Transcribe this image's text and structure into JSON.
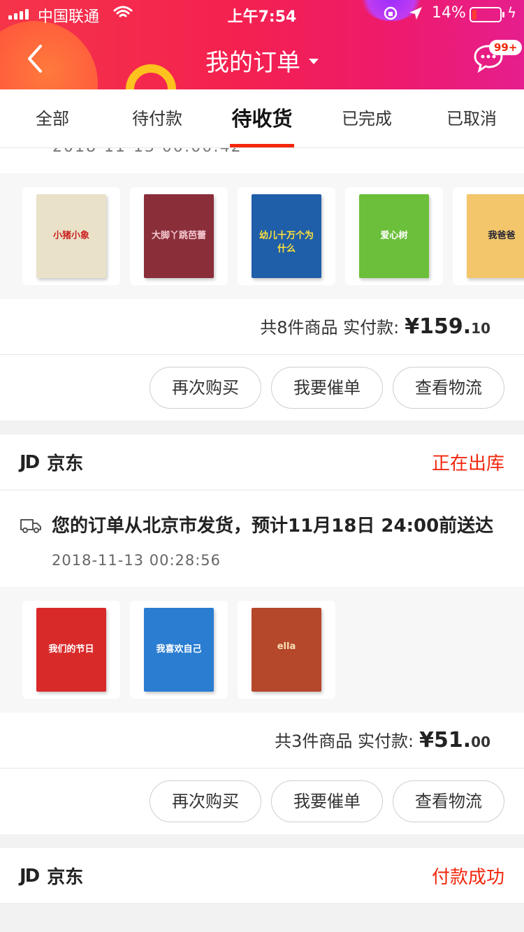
{
  "status_bar": {
    "carrier": "中国联通",
    "time": "上午7:54",
    "battery_pct": "14%"
  },
  "nav": {
    "title": "我的订单",
    "badge": "99+"
  },
  "tabs": [
    {
      "label": "全部",
      "active": false
    },
    {
      "label": "待付款",
      "active": false
    },
    {
      "label": "待收货",
      "active": true
    },
    {
      "label": "已完成",
      "active": false
    },
    {
      "label": "已取消",
      "active": false
    }
  ],
  "order1": {
    "summary_prefix": "共8件商品 实付款:",
    "price_main": "¥159.",
    "price_cents": "10",
    "books": [
      {
        "title": "小猪小象",
        "color": "#e9e2c8",
        "text": "#c22"
      },
      {
        "title": "大脚丫跳芭蕾",
        "color": "#8a2f3a",
        "text": "#f4c7cf"
      },
      {
        "title": "幼儿十万个为什么",
        "color": "#1f5ea8",
        "text": "#ffe23a"
      },
      {
        "title": "爱心树",
        "color": "#6bbf3a",
        "text": "#fff"
      },
      {
        "title": "我爸爸",
        "color": "#f3c66b",
        "text": "#223"
      }
    ]
  },
  "order2": {
    "shop_name": "京东",
    "shop_logo": "JD",
    "status": "正在出库",
    "ship_message": "您的订单从北京市发货，预计11月18日 24:00前送达",
    "ship_time": "2018-11-13 00:28:56",
    "summary_prefix": "共3件商品 实付款:",
    "price_main": "¥51.",
    "price_cents": "00",
    "books": [
      {
        "title": "我们的节日",
        "color": "#d92a2a",
        "text": "#fff"
      },
      {
        "title": "我喜欢自己",
        "color": "#2a7dd1",
        "text": "#fff"
      },
      {
        "title": "ella",
        "color": "#b5472a",
        "text": "#f7e2b6"
      }
    ]
  },
  "order3": {
    "shop_name": "京东",
    "shop_logo": "JD",
    "status": "付款成功"
  },
  "buttons": {
    "rebuy": "再次购买",
    "urge": "我要催单",
    "logistics": "查看物流"
  },
  "colors": {
    "accent": "#f2270c",
    "header_start": "#f5344a",
    "header_end": "#e61e8e"
  }
}
